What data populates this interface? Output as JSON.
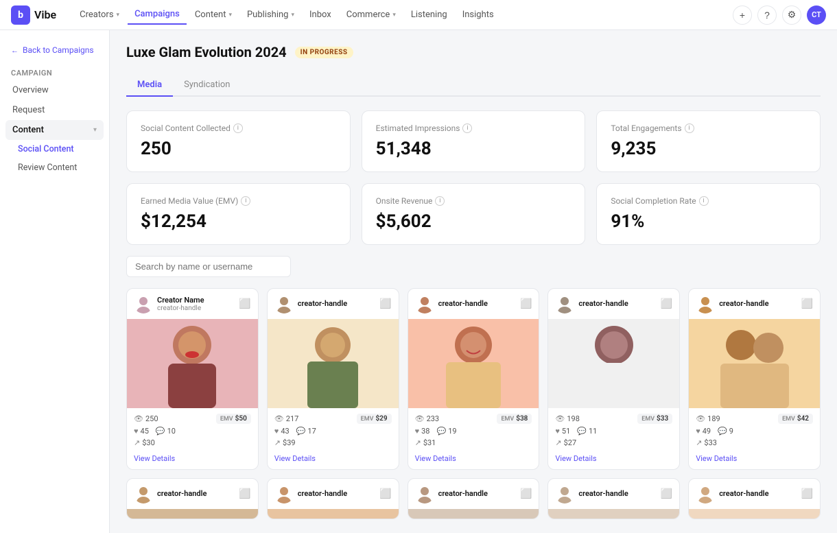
{
  "nav": {
    "logo_letter": "b",
    "logo_text": "Vibe",
    "items": [
      {
        "label": "Creators",
        "has_arrow": true,
        "active": false
      },
      {
        "label": "Campaigns",
        "has_arrow": false,
        "active": true
      },
      {
        "label": "Content",
        "has_arrow": true,
        "active": false
      },
      {
        "label": "Publishing",
        "has_arrow": true,
        "active": false
      },
      {
        "label": "Inbox",
        "has_arrow": false,
        "active": false
      },
      {
        "label": "Commerce",
        "has_arrow": true,
        "active": false
      },
      {
        "label": "Listening",
        "has_arrow": false,
        "active": false
      },
      {
        "label": "Insights",
        "has_arrow": false,
        "active": false
      }
    ],
    "actions": {
      "plus": "+",
      "help": "?",
      "settings": "⚙",
      "avatar": "CT"
    }
  },
  "sidebar": {
    "back_label": "Back to Campaigns",
    "section_label": "Campaign",
    "items": [
      {
        "label": "Overview",
        "active": false
      },
      {
        "label": "Request",
        "active": false
      }
    ],
    "content_section": "Content",
    "content_items": [
      {
        "label": "Social Content",
        "active": true
      },
      {
        "label": "Review Content",
        "active": false
      }
    ]
  },
  "page": {
    "title": "Luxe Glam Evolution 2024",
    "status": "IN PROGRESS"
  },
  "tabs": [
    {
      "label": "Media",
      "active": true
    },
    {
      "label": "Syndication",
      "active": false
    }
  ],
  "stats": [
    {
      "label": "Social Content Collected",
      "value": "250"
    },
    {
      "label": "Estimated Impressions",
      "value": "51,348"
    },
    {
      "label": "Total Engagements",
      "value": "9,235"
    },
    {
      "label": "Earned Media Value (EMV)",
      "value": "$12,254"
    },
    {
      "label": "Onsite Revenue",
      "value": "$5,602"
    },
    {
      "label": "Social Completion Rate",
      "value": "91%"
    }
  ],
  "search": {
    "placeholder": "Search by name or username"
  },
  "creators": [
    {
      "name": "Creator Name",
      "handle": "creator-handle",
      "platform": "instagram",
      "views": "250",
      "likes": "45",
      "comments": "10",
      "shares": "$30",
      "emv": "$50",
      "bg": "#e8b4b8",
      "view_details": "View Details",
      "avatar_color": "#d4a5c9"
    },
    {
      "name": "creator-handle",
      "handle": "",
      "platform": "instagram",
      "views": "217",
      "likes": "43",
      "comments": "17",
      "shares": "$39",
      "emv": "$29",
      "bg": "#f5e6c8",
      "view_details": "View Details",
      "avatar_color": "#c9b99a"
    },
    {
      "name": "creator-handle",
      "handle": "",
      "platform": "instagram",
      "views": "233",
      "likes": "38",
      "comments": "19",
      "shares": "$31",
      "emv": "$38",
      "bg": "#f9d4c0",
      "view_details": "View Details",
      "avatar_color": "#d4a08a"
    },
    {
      "name": "creator-handle",
      "handle": "",
      "platform": "instagram",
      "views": "198",
      "likes": "51",
      "comments": "11",
      "shares": "$27",
      "emv": "$33",
      "bg": "#e8e8e8",
      "view_details": "View Details",
      "avatar_color": "#b0b0b0"
    },
    {
      "name": "creator-handle",
      "handle": "",
      "platform": "instagram",
      "views": "189",
      "likes": "49",
      "comments": "9",
      "shares": "$33",
      "emv": "$42",
      "bg": "#f5d5a0",
      "view_details": "View Details",
      "avatar_color": "#d4a860"
    }
  ],
  "creators_row2": [
    {
      "name": "creator-handle",
      "bg": "#d4b896",
      "avatar_color": "#c49a6c"
    },
    {
      "name": "creator-handle",
      "bg": "#e8c4a0",
      "avatar_color": "#c8946a"
    },
    {
      "name": "creator-handle",
      "bg": "#d8c8b8",
      "avatar_color": "#b89880"
    },
    {
      "name": "creator-handle",
      "bg": "#e0d0c0",
      "avatar_color": "#c0a890"
    },
    {
      "name": "creator-handle",
      "bg": "#f0d8c0",
      "avatar_color": "#d0a880"
    }
  ]
}
